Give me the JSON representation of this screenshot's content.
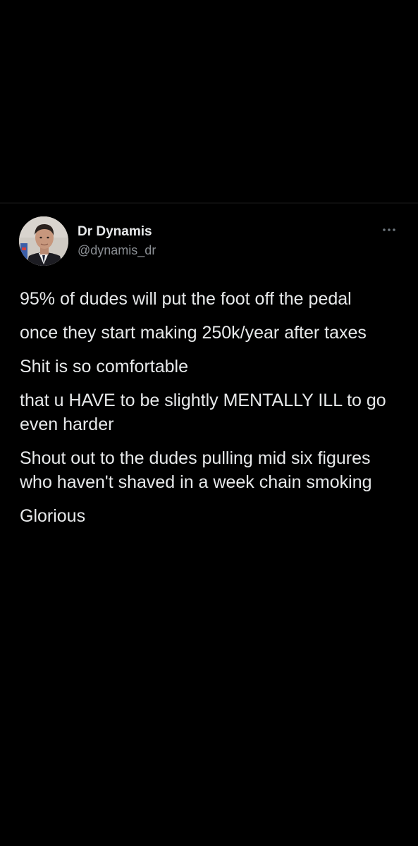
{
  "colors": {
    "background": "#000000",
    "text_primary": "#e7e9ea",
    "text_secondary": "#8b8f94"
  },
  "tweet": {
    "author": {
      "display_name": "Dr Dynamis",
      "handle": "@dynamis_dr",
      "avatar_icon": "profile-photo"
    },
    "more_icon": "more-horizontal-icon",
    "paragraphs": [
      "95% of dudes will put the foot off the pedal",
      "once they start making 250k/year after taxes",
      "Shit is so comfortable",
      "that u HAVE to be slightly MENTALLY ILL to go even harder",
      "Shout out to the dudes pulling mid six figures who haven't shaved in a week chain smoking",
      "Glorious"
    ]
  }
}
